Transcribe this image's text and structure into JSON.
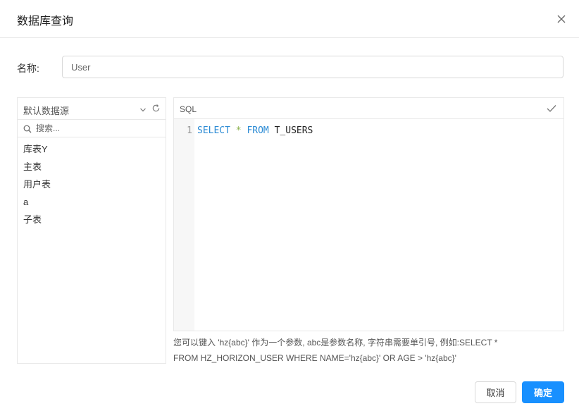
{
  "dialog": {
    "title": "数据库查询",
    "close_icon": "close-icon"
  },
  "form": {
    "name_label": "名称:",
    "name_value": "User"
  },
  "datasource": {
    "selected": "默认数据源",
    "search_placeholder": "搜索...",
    "tables": [
      "库表Y",
      "主表",
      "用户表",
      "a",
      "子表"
    ]
  },
  "editor": {
    "title": "SQL",
    "line_number": "1",
    "tokens": {
      "select": "SELECT",
      "star": "*",
      "from": "FROM",
      "table": "T_USERS"
    }
  },
  "hint": {
    "line1": "您可以键入 'hz{abc}' 作为一个参数, abc是参数名称, 字符串需要单引号, 例如:SELECT *",
    "line2": "FROM HZ_HORIZON_USER WHERE NAME='hz{abc}' OR AGE > 'hz{abc}'"
  },
  "buttons": {
    "cancel": "取消",
    "ok": "确定"
  },
  "colors": {
    "primary": "#1890ff",
    "keyword": "#2a8ad4",
    "operator": "#8ab04a",
    "border": "#e8e8e8"
  }
}
